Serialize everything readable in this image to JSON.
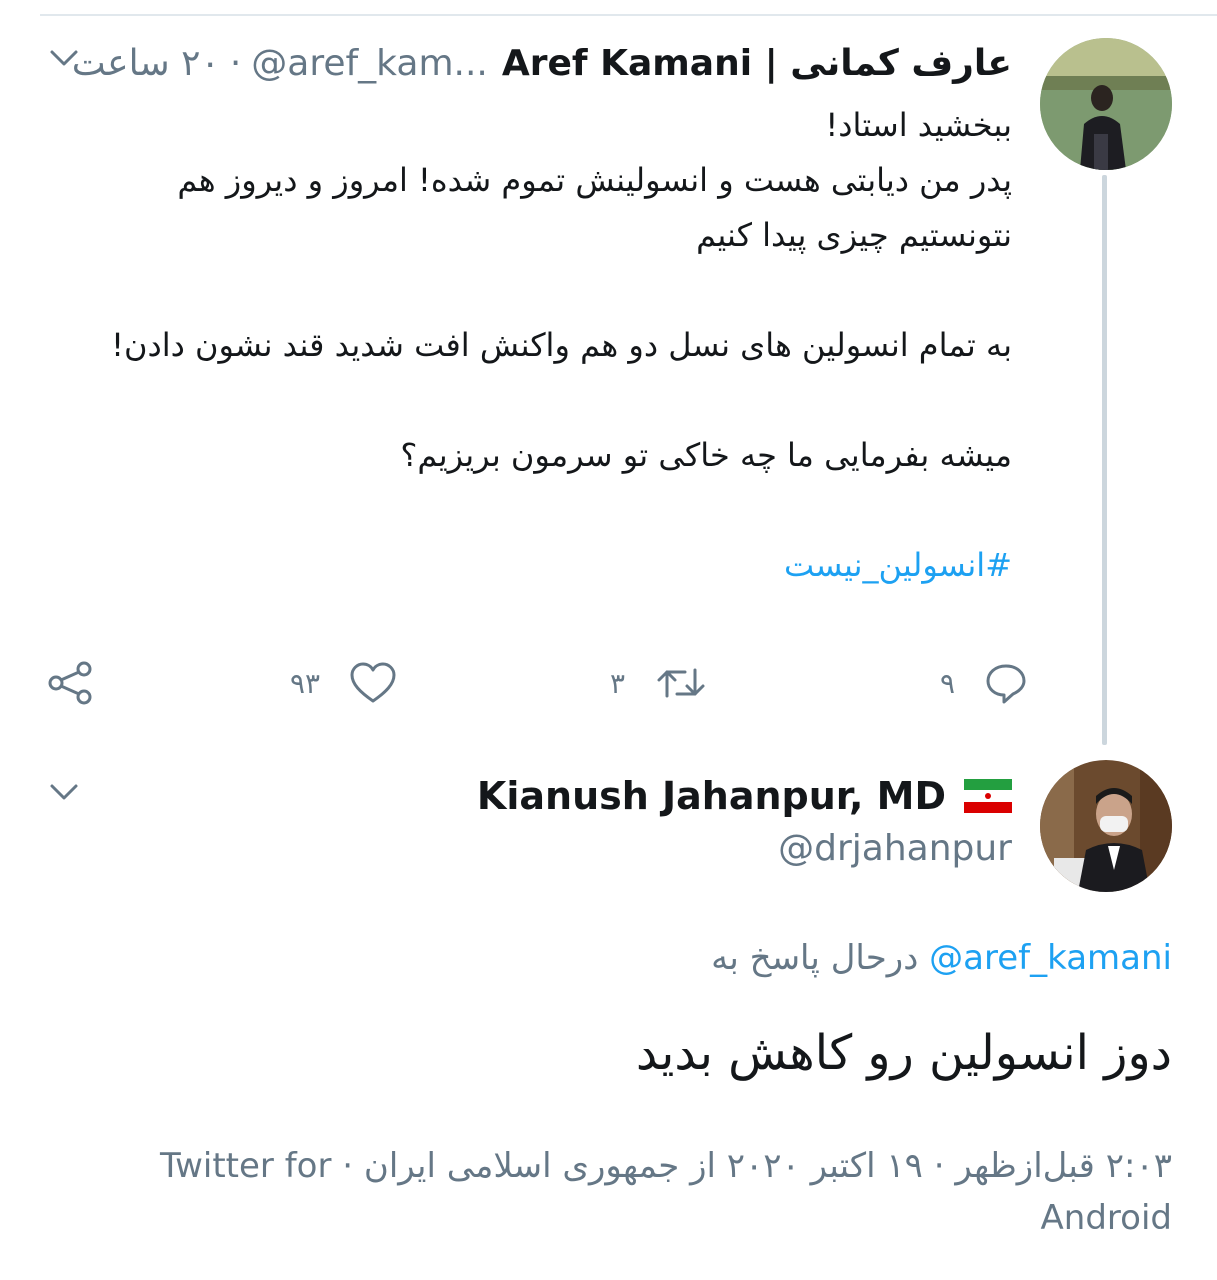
{
  "tweet1": {
    "display_name": "عارف کمانی | Aref Kamani",
    "handle": "@aref_kam...",
    "separator": "·",
    "time": "۲۰ ساعت",
    "body": {
      "line1": "ببخشید استاد!",
      "line2": "پدر من دیابتی هست و انسولینش تموم شده! امروز و دیروز هم نتونستیم چیزی پیدا کنیم",
      "line3": "به تمام انسولین های نسل دو هم واکنش افت شدید قند نشون دادن!",
      "line4": "میشه بفرمایی ما چه خاکی تو سرمون بریزیم؟",
      "hashtag": "#انسولین_نیست"
    },
    "actions": {
      "reply_count": "۹",
      "retweet_count": "۳",
      "like_count": "۹۳"
    }
  },
  "tweet2": {
    "display_name": "Kianush Jahanpur, MD",
    "flag_icon": "iran-flag-icon",
    "handle": "@drjahanpur",
    "reply_prefix": "درحال پاسخ به",
    "reply_handle": "@aref_kamani",
    "text": "دوز انسولین رو کاهش بدید",
    "meta": "۲:۰۳ قبل‌ازظهر · ۱۹ اکتبر ۲۰۲۰ از جمهوری اسلامی ایران · Twitter for Android"
  },
  "colors": {
    "link": "#1da1f2",
    "muted": "#657786",
    "text": "#14171a",
    "thread_line": "#ccd6dd"
  }
}
